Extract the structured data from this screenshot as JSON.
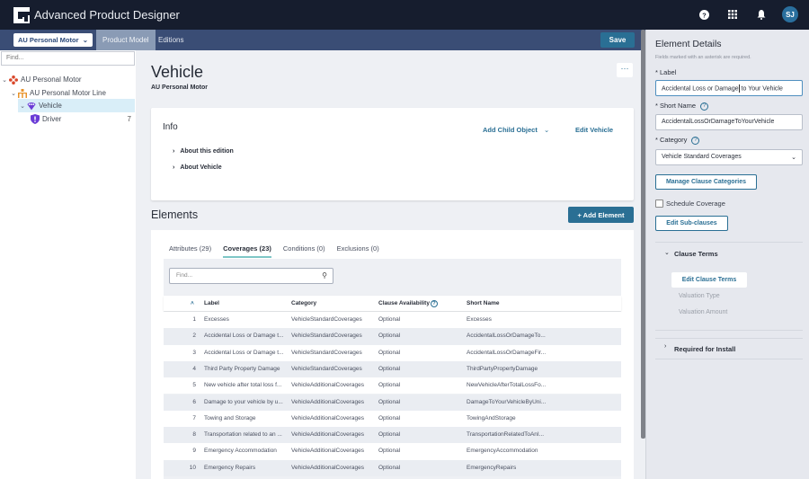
{
  "header": {
    "app_title": "Advanced Product Designer",
    "user_initials": "SJ",
    "icons": [
      "help-icon",
      "apps-grid-icon",
      "bell-icon",
      "avatar"
    ]
  },
  "nav": {
    "product_select": "AU Personal Motor",
    "tabs": [
      {
        "label": "Product Model",
        "active": true
      },
      {
        "label": "Editions",
        "active": false
      }
    ],
    "save_label": "Save"
  },
  "sidebar": {
    "find_placeholder": "Find...",
    "tree": [
      {
        "label": "AU Personal Motor",
        "icon": "product-icon",
        "expanded": true,
        "level": 0
      },
      {
        "label": "AU Personal Motor Line",
        "icon": "line-hierarchy-icon",
        "expanded": true,
        "level": 1
      },
      {
        "label": "Vehicle",
        "icon": "vehicle-shield-icon",
        "expanded": true,
        "level": 2,
        "selected": true
      },
      {
        "label": "Driver",
        "icon": "driver-shield-icon",
        "level": 3,
        "count": "7"
      }
    ]
  },
  "main": {
    "title": "Vehicle",
    "subtitle": "AU Personal Motor",
    "more_label": "···",
    "info": {
      "title": "Info",
      "add_child_label": "Add Child Object",
      "edit_label": "Edit Vehicle",
      "expanders": [
        "About this edition",
        "About Vehicle"
      ]
    },
    "elements": {
      "title": "Elements",
      "add_label": "+ Add Element",
      "tabs": [
        {
          "label": "Attributes (29)",
          "active": false
        },
        {
          "label": "Coverages (23)",
          "active": true
        },
        {
          "label": "Conditions (0)",
          "active": false
        },
        {
          "label": "Exclusions (0)",
          "active": false
        }
      ],
      "find_placeholder": "Find...",
      "columns": [
        "Label",
        "Category",
        "Clause Availability",
        "Short Name"
      ],
      "rows": [
        {
          "n": "1",
          "label": "Excesses",
          "category": "VehicleStandardCoverages",
          "availability": "Optional",
          "short": "Excesses"
        },
        {
          "n": "2",
          "label": "Accidental Loss or Damage t...",
          "category": "VehicleStandardCoverages",
          "availability": "Optional",
          "short": "AccidentalLossOrDamageTo..."
        },
        {
          "n": "3",
          "label": "Accidental Loss or Damage t...",
          "category": "VehicleStandardCoverages",
          "availability": "Optional",
          "short": "AccidentalLossOrDamageFir..."
        },
        {
          "n": "4",
          "label": "Third Party Property Damage",
          "category": "VehicleStandardCoverages",
          "availability": "Optional",
          "short": "ThirdPartyPropertyDamage"
        },
        {
          "n": "5",
          "label": "New vehicle after total loss f...",
          "category": "VehicleAdditionalCoverages",
          "availability": "Optional",
          "short": "NewVehicleAfterTotalLossFo..."
        },
        {
          "n": "6",
          "label": "Damage to your vehicle by u...",
          "category": "VehicleAdditionalCoverages",
          "availability": "Optional",
          "short": "DamageToYourVehicleByUni..."
        },
        {
          "n": "7",
          "label": "Towing and Storage",
          "category": "VehicleAdditionalCoverages",
          "availability": "Optional",
          "short": "TowingAndStorage"
        },
        {
          "n": "8",
          "label": "Transportation related to an ...",
          "category": "VehicleAdditionalCoverages",
          "availability": "Optional",
          "short": "TransportationRelatedToAnI..."
        },
        {
          "n": "9",
          "label": "Emergency Accommodation",
          "category": "VehicleAdditionalCoverages",
          "availability": "Optional",
          "short": "EmergencyAccommodation"
        },
        {
          "n": "10",
          "label": "Emergency Repairs",
          "category": "VehicleAdditionalCoverages",
          "availability": "Optional",
          "short": "EmergencyRepairs"
        }
      ]
    }
  },
  "details": {
    "title": "Element Details",
    "note": "Fields marked with an asterisk are required.",
    "label_label": "* Label",
    "label_value_before": "Accidental Loss or Damage",
    "label_value_after": " to Your Vehicle",
    "short_name_label": "* Short Name",
    "short_name_value": "AccidentalLossOrDamageToYourVehicle",
    "category_label": "* Category",
    "category_value": "Vehicle Standard Coverages",
    "manage_categories_label": "Manage Clause Categories",
    "schedule_coverage_label": "Schedule Coverage",
    "schedule_coverage_checked": false,
    "edit_subclauses_label": "Edit Sub-clauses",
    "clause_terms": {
      "title": "Clause Terms",
      "edit_label": "Edit Clause Terms",
      "items": [
        "Valuation Type",
        "Valuation Amount"
      ]
    },
    "required_install_label": "Required for Install"
  }
}
